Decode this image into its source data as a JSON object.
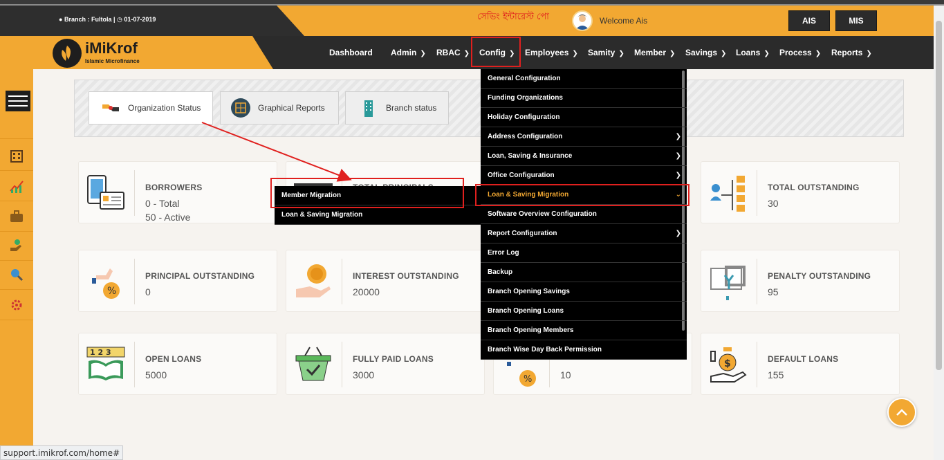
{
  "topbar": {
    "branch_label": "Branch : Fultola |",
    "date": "01-07-2019",
    "bangla_text": "সেভিং ইন্টারেস্ট পো",
    "welcome": "Welcome Ais",
    "btn_ais": "AIS",
    "btn_mis": "MIS"
  },
  "logo": {
    "name": "iMiKrof",
    "subtitle": "Islamic Microfinance"
  },
  "nav": {
    "items": [
      "Dashboard",
      "Admin",
      "RBAC",
      "Config",
      "Employees",
      "Samity",
      "Member",
      "Savings",
      "Loans",
      "Process",
      "Reports"
    ]
  },
  "tabs": {
    "org": "Organization Status",
    "graph": "Graphical Reports",
    "branch": "Branch status"
  },
  "cards": {
    "borrowers": {
      "title": "BORROWERS",
      "line1": "0 - Total",
      "line2": "50 - Active"
    },
    "total_principals": {
      "title": "TOTAL PRINCIPALS"
    },
    "total_outstanding": {
      "title": "TOTAL OUTSTANDING",
      "value": "30"
    },
    "principal_outstanding": {
      "title": "PRINCIPAL OUTSTANDING",
      "value": "0"
    },
    "interest_outstanding": {
      "title": "INTEREST OUTSTANDING",
      "value": "20000"
    },
    "penalty_outstanding": {
      "title": "PENALTY OUTSTANDING",
      "value": "95"
    },
    "open_loans": {
      "title": "OPEN LOANS",
      "value": "5000"
    },
    "fully_paid_loans": {
      "title": "FULLY PAID LOANS",
      "value": "3000"
    },
    "rescheduled_loans": {
      "value": "10"
    },
    "default_loans": {
      "title": "DEFAULT LOANS",
      "value": "155"
    }
  },
  "config_menu": {
    "items": [
      "General Configuration",
      "Funding Organizations",
      "Holiday Configuration",
      "Address Configuration",
      "Loan, Saving & Insurance",
      "Office Configuration",
      "Loan & Saving Migration",
      "Software Overview Configuration",
      "Report Configuration",
      "Error Log",
      "Backup",
      "Branch Opening Savings",
      "Branch Opening Loans",
      "Branch Opening Members",
      "Branch Wise Day Back Permission"
    ]
  },
  "submenu": {
    "items": [
      "Member Migration",
      "Loan & Saving Migration"
    ]
  },
  "status_url": "support.imikrof.com/home#",
  "colors": {
    "accent": "#f2a832",
    "dark": "#2b2b2b",
    "highlight": "#e0201e"
  }
}
